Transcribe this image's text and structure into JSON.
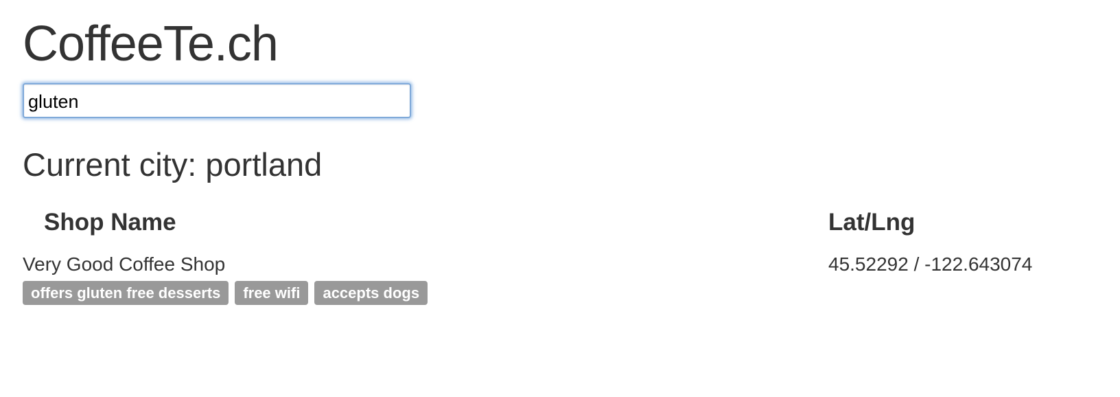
{
  "app": {
    "title": "CoffeeTe.ch"
  },
  "search": {
    "value": "gluten",
    "placeholder": ""
  },
  "city": {
    "heading": "Current city: portland"
  },
  "table": {
    "headers": {
      "shop_name": "Shop Name",
      "lat_lng": "Lat/Lng"
    },
    "rows": [
      {
        "shop_name": "Very Good Coffee Shop",
        "lat_lng": "45.52292 / -122.643074",
        "tags": [
          "offers gluten free desserts",
          "free wifi",
          "accepts dogs"
        ]
      }
    ]
  },
  "colors": {
    "text": "#333333",
    "tag_background": "#999999",
    "tag_text": "#ffffff",
    "input_focus": "#7fa9d9"
  }
}
